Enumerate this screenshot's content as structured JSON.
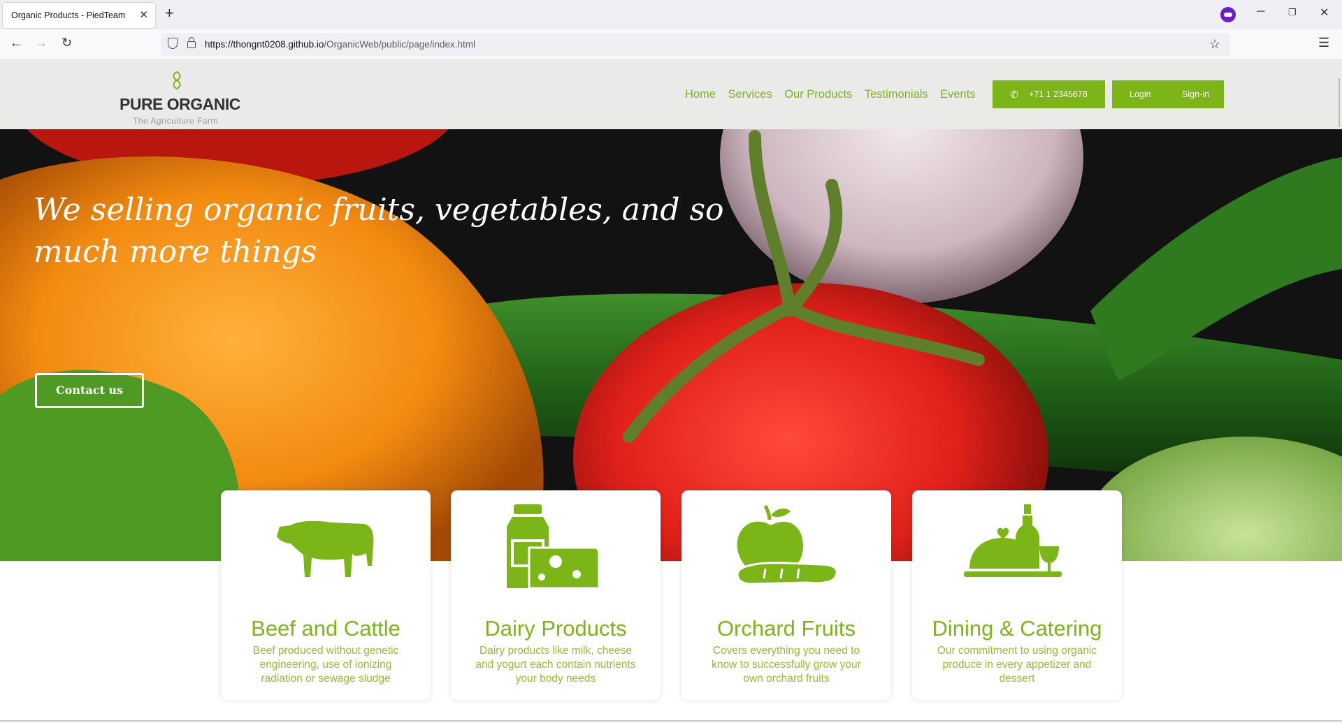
{
  "browser": {
    "tab_title": "Organic Products - PiedTeam",
    "tab_close": "✕",
    "new_tab": "+",
    "url_host": "https://thongnt0208.github.io",
    "url_path": "/OrganicWeb/public/page/index.html",
    "icons": [
      "back-arrow-icon",
      "forward-arrow-icon",
      "reload-icon",
      "shield-icon",
      "lock-icon",
      "star-icon",
      "menu-icon",
      "private-browsing-icon"
    ]
  },
  "header": {
    "logo_main": "PURE ORGANIC",
    "logo_sub": "The Agriculture Farm",
    "nav": [
      "Home",
      "Services",
      "Our Products",
      "Testimonials",
      "Events"
    ],
    "phone": "+71 1 2345678",
    "login": "Login",
    "signin": "Sign-in"
  },
  "hero": {
    "title": "We selling organic fruits, vegetables, and so much more things",
    "cta": "Contact us"
  },
  "cards": [
    {
      "icon": "cow-icon",
      "title": "Beef and Cattle",
      "desc": "Beef produced without genetic engineering, use of ionizing radiation or sewage sludge"
    },
    {
      "icon": "dairy-icon",
      "title": "Dairy Products",
      "desc": "Dairy products like milk, cheese and yogurt each contain nutrients your body needs"
    },
    {
      "icon": "fruit-icon",
      "title": "Orchard Fruits",
      "desc": "Covers everything you need to know to successfully grow your own orchard fruits"
    },
    {
      "icon": "catering-icon",
      "title": "Dining & Catering",
      "desc": "Our commitment to using organic produce in every appetizer and dessert"
    }
  ],
  "colors": {
    "accent": "#7cb518",
    "header_bg": "#eaeae8"
  }
}
